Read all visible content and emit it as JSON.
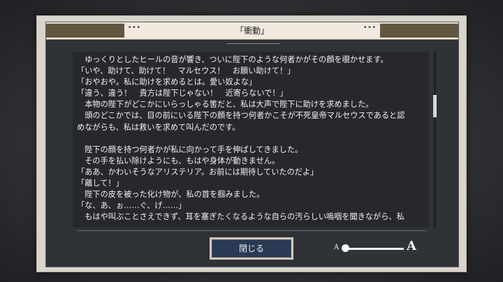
{
  "dialog": {
    "title": "「衝動」",
    "title_dots": "•••"
  },
  "log": {
    "lines": [
      "　ゆっくりとしたヒールの音が響き、ついに陛下のような何者かがその顔を覗かせます。",
      "「いや、助けて、助けて！　マルセウス！　お願い助けて！」",
      "「おやおや。私に助けを求めるとは。愛い奴よな」",
      "「違う、違う！　貴方は陛下じゃない！　近寄らないで！」",
      "　本物の陛下がどこかにいらっしゃる筈だと、私は大声で陛下に助けを求めました。",
      "　頭のどこかでは、目の前にいる陛下の顔を持つ何者かこそが不死皇帝マルセウスであると認",
      "めながらも、私は救いを求めて叫んだのです。",
      "",
      "　陛下の顔を持つ何者かが私に向かって手を伸ばしてきました。",
      "　その手を払い除けようにも、もはや身体が動きません。",
      "「ああ、かわいそうなアリステリア。お前には期待していたのだよ」",
      "「離して！」",
      "　陛下の皮を被った化け物が、私の首を掴みました。",
      "「な、あ、ぉ……ぐ、げ……」",
      "　もはや叫ぶことさえできず、耳を塞ぎたくなるような自らの汚らしい嗚咽を聞きながら、私"
    ],
    "scroll_fraction": 0.28
  },
  "buttons": {
    "close_label": "閉じる"
  },
  "text_size": {
    "small_label": "A",
    "large_label": "A",
    "level": 0.0
  }
}
